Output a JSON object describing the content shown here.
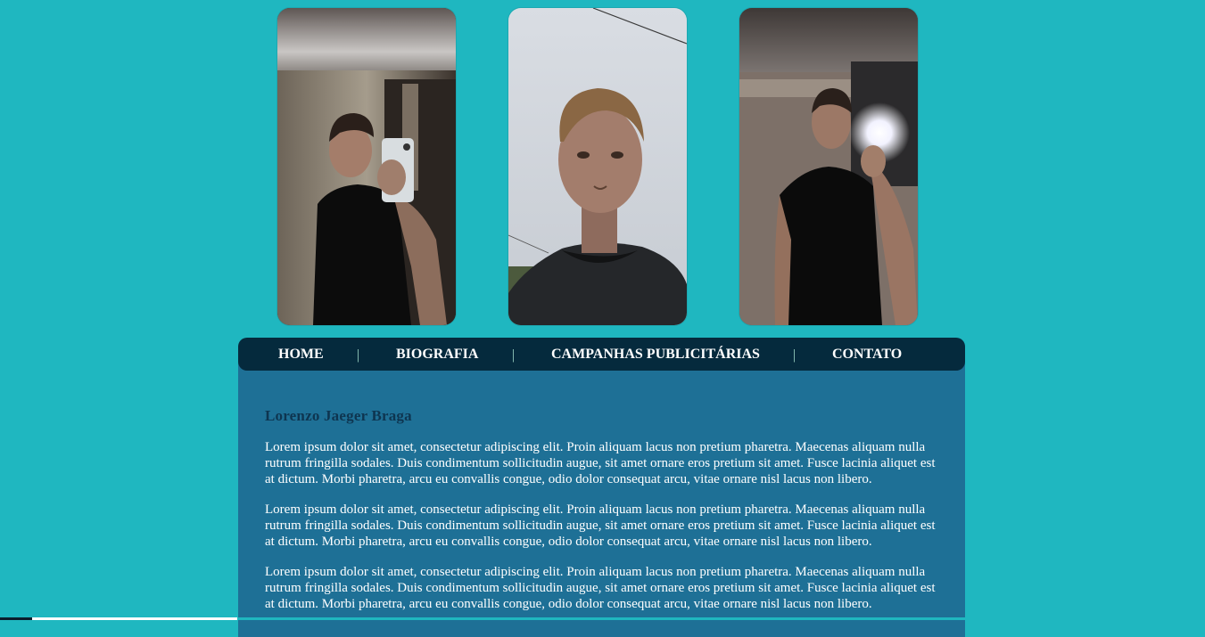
{
  "gallery": {
    "photos": [
      {
        "alt": "photo-mirror-selfie-1"
      },
      {
        "alt": "photo-portrait-close"
      },
      {
        "alt": "photo-mirror-selfie-2"
      }
    ]
  },
  "nav": {
    "items": [
      {
        "label": "HOME"
      },
      {
        "label": "BIOGRAFIA"
      },
      {
        "label": "CAMPANHAS PUBLICITÁRIAS"
      },
      {
        "label": "CONTATO"
      }
    ],
    "separator": "|"
  },
  "content": {
    "title": "Lorenzo Jaeger Braga",
    "paragraphs": [
      "Lorem ipsum dolor sit amet, consectetur adipiscing elit. Proin aliquam lacus non pretium pharetra. Maecenas aliquam nulla rutrum fringilla sodales. Duis condimentum sollicitudin augue, sit amet ornare eros pretium sit amet. Fusce lacinia aliquet est at dictum. Morbi pharetra, arcu eu convallis congue, odio dolor consequat arcu, vitae ornare nisl lacus non libero.",
      "Lorem ipsum dolor sit amet, consectetur adipiscing elit. Proin aliquam lacus non pretium pharetra. Maecenas aliquam nulla rutrum fringilla sodales. Duis condimentum sollicitudin augue, sit amet ornare eros pretium sit amet. Fusce lacinia aliquet est at dictum. Morbi pharetra, arcu eu convallis congue, odio dolor consequat arcu, vitae ornare nisl lacus non libero.",
      "Lorem ipsum dolor sit amet, consectetur adipiscing elit. Proin aliquam lacus non pretium pharetra. Maecenas aliquam nulla rutrum fringilla sodales. Duis condimentum sollicitudin augue, sit amet ornare eros pretium sit amet. Fusce lacinia aliquet est at dictum. Morbi pharetra, arcu eu convallis congue, odio dolor consequat arcu, vitae ornare nisl lacus non libero."
    ]
  },
  "colors": {
    "page_background": "#1fb7c0",
    "nav_background": "#052a3d",
    "content_background": "#1e7096",
    "title_color": "#0e3550"
  }
}
